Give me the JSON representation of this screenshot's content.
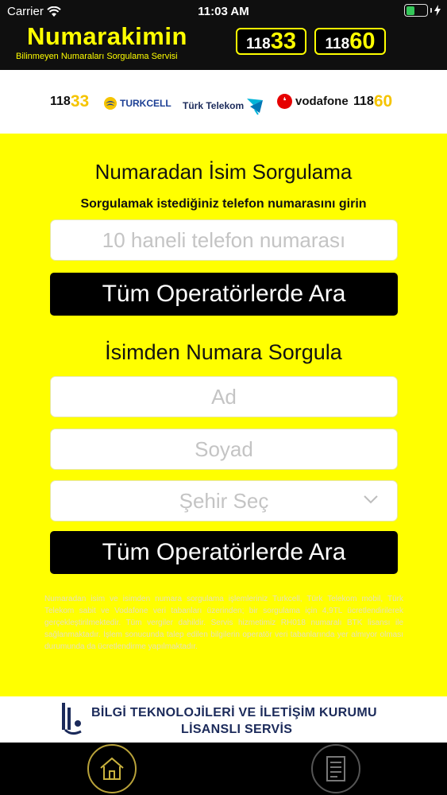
{
  "status_bar": {
    "carrier": "Carrier",
    "time": "11:03 AM"
  },
  "header": {
    "title": "Numarakimin",
    "subtitle": "Bilinmeyen Numaraları Sorgulama Servisi",
    "badges": [
      {
        "prefix": "118",
        "suffix": "33"
      },
      {
        "prefix": "118",
        "suffix": "60"
      }
    ]
  },
  "operators": {
    "left_service": {
      "prefix": "118",
      "suffix": "33"
    },
    "turkcell": "TURKCELL",
    "turk_telekom": "Türk Telekom",
    "vodafone": "vodafone",
    "right_service": {
      "prefix": "118",
      "suffix": "60"
    }
  },
  "name_lookup": {
    "title": "Numaradan İsim Sorgulama",
    "subtitle": "Sorgulamak istediğiniz telefon numarasını girin",
    "phone_placeholder": "10 haneli telefon numarası",
    "phone_value": "",
    "search_button": "Tüm Operatörlerde Ara"
  },
  "number_lookup": {
    "title": "İsimden Numara Sorgula",
    "name_placeholder": "Ad",
    "surname_placeholder": "Soyad",
    "city_placeholder": "Şehir Seç",
    "search_button": "Tüm Operatörlerde Ara"
  },
  "disclaimer": "Numaradan isim ve isimden numara sorgulama işlemleriniz Turkcell, Türk Telekom mobil, Türk Telekom sabit ve Vodafone veri tabanları üzerinden; bir sorgulama için 4,9TL ücretlendirilerek gerçekleştirilmektedir. Tüm vergiler dahildir. Servis hizmetimiz RH018 numaralı BTK lisansı ile sağlanmaktadır. İşlem sonucunda talep edilen bilgilerin operatör veri tabanlarında yer almıyor olması durumunda da ücretlendirme yapılmaktadır.",
  "license": {
    "line1": "BİLGİ TEKNOLOJİLERİ VE İLETİŞİM KURUMU",
    "line2": "LİSANSLI SERVİS"
  },
  "tabbar": {
    "items": [
      {
        "icon": "home-icon"
      },
      {
        "icon": "document-list-icon"
      }
    ]
  },
  "colors": {
    "background": "#FFFF00",
    "header": "#0f0f0f",
    "button": "#000000",
    "vodafone_red": "#e60000",
    "turkcell_blue": "#1c3f94"
  }
}
